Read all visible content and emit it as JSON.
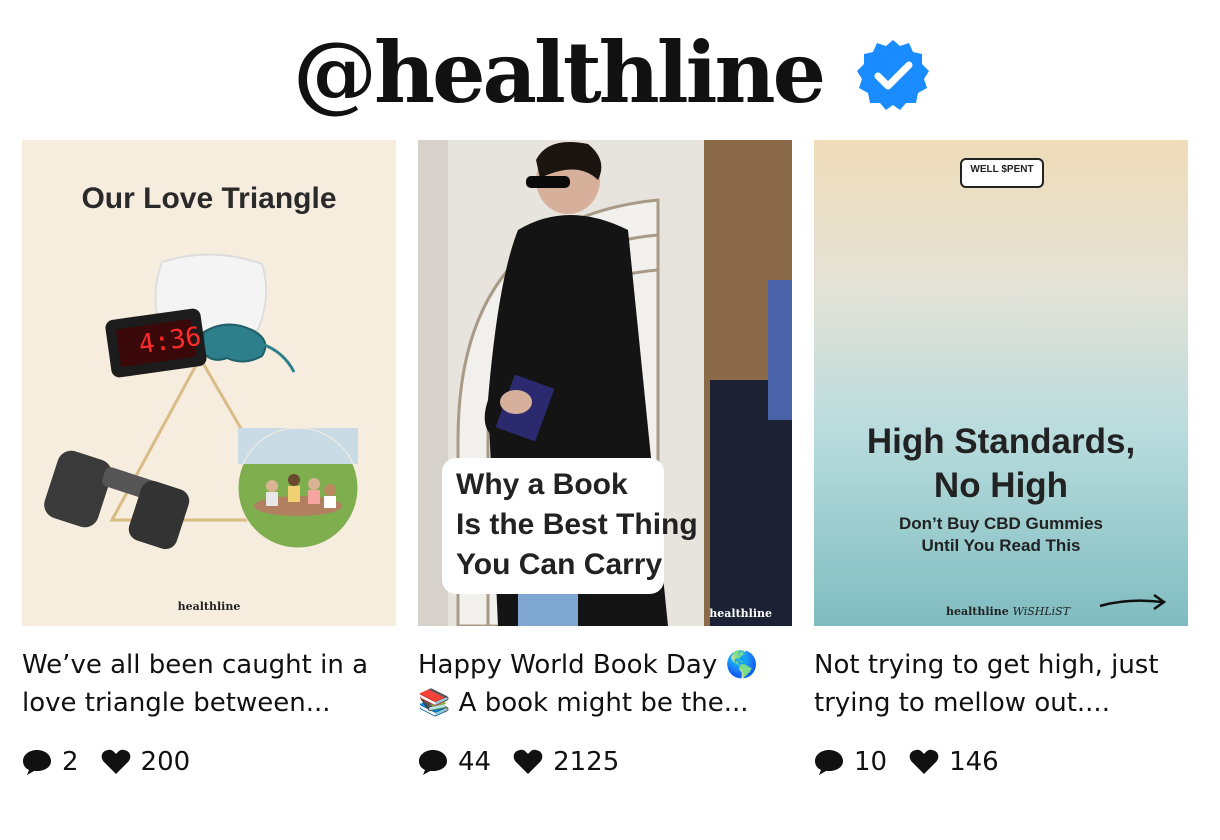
{
  "header": {
    "handle": "@healthline"
  },
  "brand": {
    "verified_color": "#1a8cff"
  },
  "posts": [
    {
      "image": {
        "headline": "Our Love Triangle",
        "clock_time": "4:36",
        "brand": "healthline",
        "bg": "#f7eddf"
      },
      "caption_line1": "We’ve all been caught in a",
      "caption_line2": "love triangle between...",
      "comments": "2",
      "likes": "200"
    },
    {
      "image": {
        "headline_line1": "Why a Book",
        "headline_line2": "Is the Best Thing",
        "headline_line3": "You Can Carry",
        "brand": "healthline"
      },
      "caption_line1": "Happy World Book Day 🌎",
      "caption_line2": "📚 A book might be the...",
      "comments": "44",
      "likes": "2125"
    },
    {
      "image": {
        "tag": "WELL $PENT",
        "headline_line1": "High Standards,",
        "headline_line2": "No High",
        "sub_line1": "Don’t Buy CBD Gummies",
        "sub_line2": "Until You Read This",
        "brand": "healthline",
        "brand_suffix": "WiSHLiST"
      },
      "caption_line1": "Not trying to get high, just",
      "caption_line2": "trying to mellow out....",
      "comments": "10",
      "likes": "146"
    }
  ]
}
